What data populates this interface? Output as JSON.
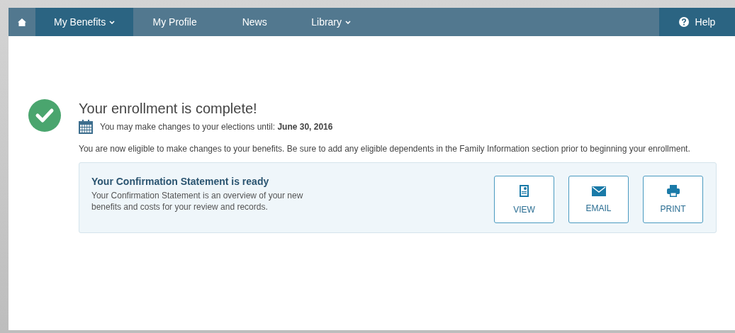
{
  "nav": {
    "items": [
      {
        "kind": "home",
        "selected": false
      },
      {
        "kind": "link",
        "label": "My Benefits",
        "selected": true,
        "dropdown": true
      },
      {
        "kind": "link",
        "label": "My Profile",
        "selected": false,
        "dropdown": false
      },
      {
        "kind": "link",
        "label": "News",
        "selected": false,
        "dropdown": false
      },
      {
        "kind": "link",
        "label": "Library",
        "selected": false,
        "dropdown": true
      }
    ],
    "help": {
      "label": "Help"
    }
  },
  "status": {
    "title": "Your enrollment is complete!",
    "deadline_text": "You may make changes to your elections until:",
    "deadline_date": "June 30, 2016"
  },
  "notice": "You are now eligible to make changes to your benefits. Be sure to add any eligible dependents in the Family Information section prior to beginning your enrollment.",
  "statement": {
    "title": "Your Confirmation Statement is ready",
    "description": "Your Confirmation Statement is an overview of your new benefits and costs for your review and records.",
    "actions": [
      {
        "kind": "view",
        "label": "VIEW"
      },
      {
        "kind": "email",
        "label": "EMAIL"
      },
      {
        "kind": "print",
        "label": "PRINT"
      }
    ]
  }
}
